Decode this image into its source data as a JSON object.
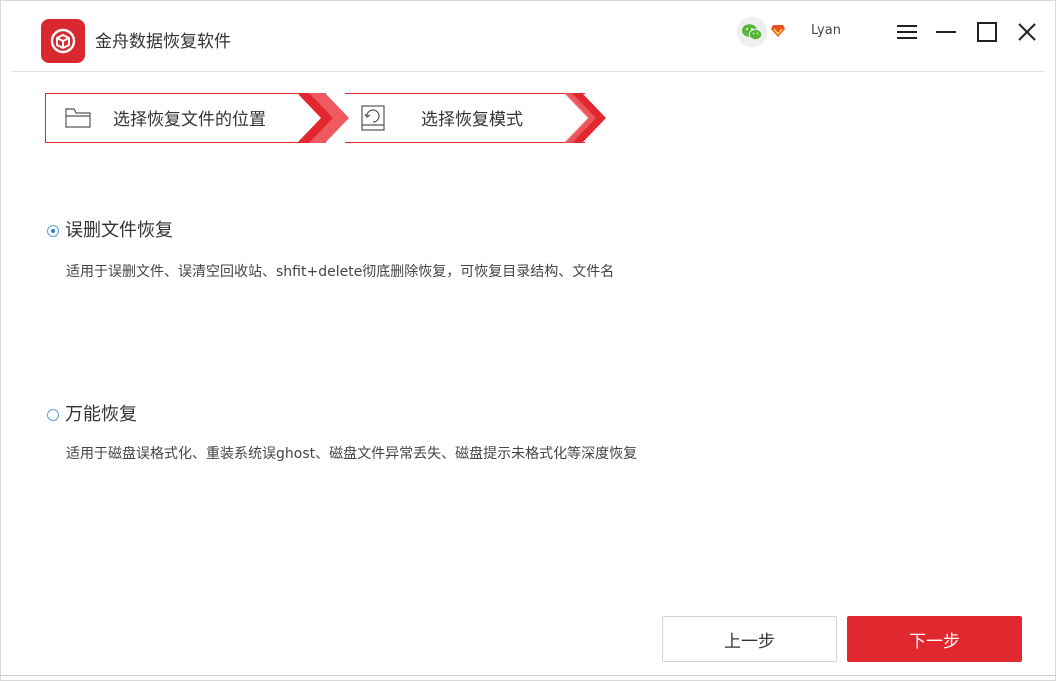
{
  "app": {
    "title": "金舟数据恢复软件",
    "username": "Lyan",
    "brand_color": "#e2282f"
  },
  "titlebar": {
    "icons": [
      "wechat-icon",
      "vip-diamond-icon",
      "menu-icon",
      "minimize-icon",
      "maximize-icon",
      "close-icon"
    ]
  },
  "steps": [
    {
      "label": "选择恢复文件的位置",
      "icon": "folder-icon"
    },
    {
      "label": "选择恢复模式",
      "icon": "restore-disk-icon"
    }
  ],
  "options": [
    {
      "title": "误删文件恢复",
      "description": "适用于误删文件、误清空回收站、shfit+delete彻底删除恢复，可恢复目录结构、文件名",
      "selected": true
    },
    {
      "title": "万能恢复",
      "description": "适用于磁盘误格式化、重装系统误ghost、磁盘文件异常丢失、磁盘提示未格式化等深度恢复",
      "selected": false
    }
  ],
  "buttons": {
    "prev": "上一步",
    "next": "下一步"
  }
}
